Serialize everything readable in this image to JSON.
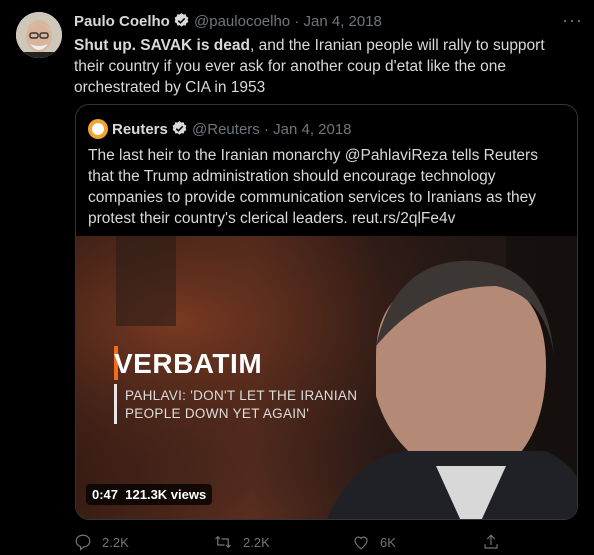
{
  "tweet": {
    "name": "Paulo Coelho",
    "handle": "@paulocoelho",
    "separator": "·",
    "date": "Jan 4, 2018",
    "text_bold": "Shut up. SAVAK is dead",
    "text_rest": ", and the Iranian people will rally to support their country if you ever ask for another coup d'etat like the one orchestrated by CIA in 1953"
  },
  "quote": {
    "name": "Reuters",
    "handle": "@Reuters",
    "separator": "·",
    "date": "Jan 4, 2018",
    "text": "The last heir to the Iranian monarchy @PahlaviReza tells Reuters that the Trump administration should encourage technology companies to provide communication services to Iranians as they protest their country's clerical leaders. reut.rs/2qlFe4v",
    "video": {
      "overlay_title": "VERBATIM",
      "overlay_line1": "PAHLAVI: 'DON'T LET THE IRANIAN",
      "overlay_line2": "PEOPLE DOWN YET AGAIN'",
      "duration": "0:47",
      "views": "121.3K views"
    }
  },
  "actions": {
    "reply_count": "2.2K",
    "retweet_count": "2.2K",
    "like_count": "6K"
  },
  "colors": {
    "verified": "#d9d9d9",
    "muted": "#6e767d",
    "accent_bar": "#f06c1e"
  }
}
